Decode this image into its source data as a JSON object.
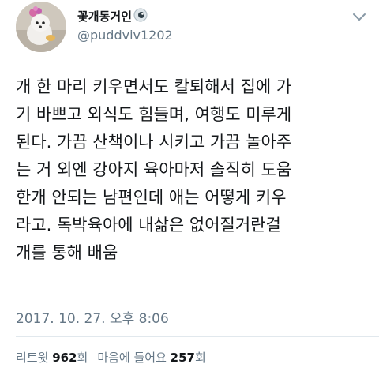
{
  "user": {
    "display_name": "꽃개동거인",
    "name_emoji": "eye-emoji",
    "handle": "@puddviv1202",
    "avatar": "dog-avatar"
  },
  "menu_icon": "chevron-down-icon",
  "tweet": {
    "lines": [
      "개 한 마리 키우면서도 칼퇴해서 집에 가",
      "기 바쁘고 외식도 힘들며, 여행도 미루게",
      "된다. 가끔 산책이나 시키고 가끔 놀아주",
      "는 거 외엔 강아지 육아마저 솔직히 도움",
      "한개 안되는 남편인데 애는 어떻게 키우",
      "라고. 독박육아에 내삶은 없어질거란걸",
      "개를 통해 배움"
    ],
    "timestamp": "2017. 10. 27. 오후 8:06"
  },
  "stats": {
    "retweets_label_before": "리트윗",
    "retweets_count": "962",
    "retweets_label_after": "회",
    "likes_label_before": "마음에 들어요",
    "likes_count": "257",
    "likes_label_after": "회"
  },
  "colors": {
    "text": "#14171a",
    "secondary": "#657786",
    "divider": "#e1e8ed"
  }
}
